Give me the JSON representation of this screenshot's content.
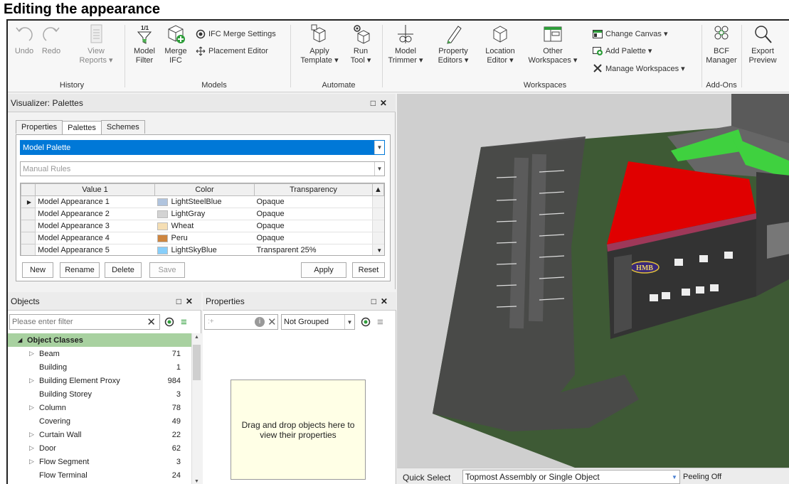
{
  "heading": "Editing the appearance",
  "ribbon": {
    "undo": "Undo",
    "redo": "Redo",
    "view_reports": [
      "View",
      "Reports ▾"
    ],
    "history_group": "History",
    "model_filter": [
      "Model",
      "Filter"
    ],
    "merge_ifc": [
      "Merge",
      "IFC"
    ],
    "ifc_merge_settings": "IFC Merge Settings",
    "placement_editor": "Placement Editor",
    "models_group": "Models",
    "apply_template": [
      "Apply",
      "Template ▾"
    ],
    "run_tool": [
      "Run",
      "Tool ▾"
    ],
    "automate_group": "Automate",
    "model_trimmer": [
      "Model",
      "Trimmer ▾"
    ],
    "property_editors": [
      "Property",
      "Editors ▾"
    ],
    "location_editor": [
      "Location",
      "Editor ▾"
    ],
    "other_workspaces": [
      "Other",
      "Workspaces ▾"
    ],
    "change_canvas": "Change Canvas ▾",
    "add_palette": "Add Palette ▾",
    "manage_workspaces": "Manage Workspaces ▾",
    "workspaces_group": "Workspaces",
    "bcf_manager": [
      "BCF",
      "Manager"
    ],
    "addons_group": "Add-Ons",
    "export_preview": [
      "Export",
      "Preview"
    ],
    "model_filter_badge": "1/1"
  },
  "visualizer": {
    "title": "Visualizer: Palettes",
    "tabs": [
      "Properties",
      "Palettes",
      "Schemes"
    ],
    "palette_select": "Model Palette",
    "rules_select": "Manual Rules",
    "columns": [
      "Value 1",
      "Color",
      "Transparency"
    ],
    "rows": [
      {
        "value": "Model Appearance 1",
        "color": "LightSteelBlue",
        "swatch": "#b0c4de",
        "transparency": "Opaque"
      },
      {
        "value": "Model Appearance 2",
        "color": "LightGray",
        "swatch": "#d3d3d3",
        "transparency": "Opaque"
      },
      {
        "value": "Model Appearance 3",
        "color": "Wheat",
        "swatch": "#f5deb3",
        "transparency": "Opaque"
      },
      {
        "value": "Model Appearance 4",
        "color": "Peru",
        "swatch": "#cd853f",
        "transparency": "Opaque"
      },
      {
        "value": "Model Appearance 5",
        "color": "LightSkyBlue",
        "swatch": "#87cefa",
        "transparency": "Transparent 25%"
      }
    ],
    "buttons": {
      "new": "New",
      "rename": "Rename",
      "delete": "Delete",
      "save": "Save",
      "apply": "Apply",
      "reset": "Reset"
    }
  },
  "objects": {
    "title": "Objects",
    "filter_placeholder": "Please enter filter",
    "root": "Object Classes",
    "items": [
      {
        "label": "Beam",
        "count": "71",
        "expandable": true
      },
      {
        "label": "Building",
        "count": "1",
        "expandable": false
      },
      {
        "label": "Building Element Proxy",
        "count": "984",
        "expandable": true
      },
      {
        "label": "Building Storey",
        "count": "3",
        "expandable": false
      },
      {
        "label": "Column",
        "count": "78",
        "expandable": true
      },
      {
        "label": "Covering",
        "count": "49",
        "expandable": false
      },
      {
        "label": "Curtain Wall",
        "count": "22",
        "expandable": true
      },
      {
        "label": "Door",
        "count": "62",
        "expandable": true
      },
      {
        "label": "Flow Segment",
        "count": "3",
        "expandable": true
      },
      {
        "label": "Flow Terminal",
        "count": "24",
        "expandable": false
      }
    ]
  },
  "properties": {
    "title": "Properties",
    "grouping": "Not Grouped",
    "search_hint": ":+",
    "dropzone": "Drag and drop objects here to view their properties"
  },
  "viewport": {
    "sign_text": "HMB"
  },
  "status": {
    "quick_select_label": "Quick Select",
    "quick_select_value": "Topmost Assembly or Single Object",
    "peeling": "Peeling Off"
  },
  "colors": {
    "selection": "#0078d7",
    "green_header": "#a8d1a0",
    "roof_red": "#e00000",
    "grass": "#3e5a35"
  }
}
